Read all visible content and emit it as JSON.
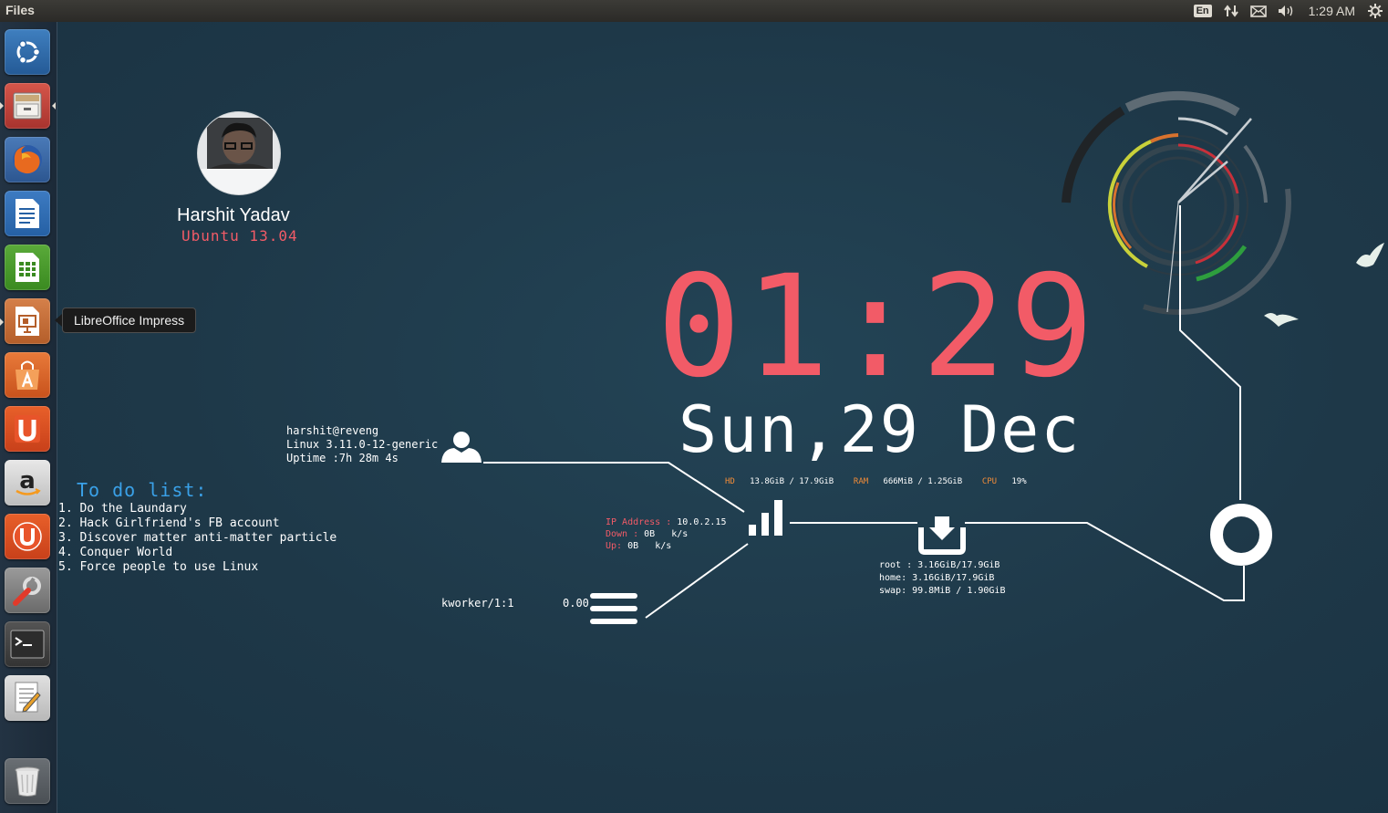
{
  "top_panel": {
    "app_title": "Files",
    "keyboard_layout": "En",
    "clock": "1:29 AM",
    "icons": [
      "network-transfer-icon",
      "mail-icon",
      "volume-icon",
      "gear-icon"
    ]
  },
  "launcher": {
    "items": [
      {
        "name": "dash-home",
        "icon": "ubuntu-logo-icon"
      },
      {
        "name": "files",
        "icon": "file-cabinet-icon",
        "active": true
      },
      {
        "name": "firefox",
        "icon": "firefox-icon"
      },
      {
        "name": "libreoffice-writer",
        "icon": "writer-icon"
      },
      {
        "name": "libreoffice-calc",
        "icon": "calc-icon"
      },
      {
        "name": "libreoffice-impress",
        "icon": "impress-icon"
      },
      {
        "name": "ubuntu-software-center",
        "icon": "shopping-bag-icon"
      },
      {
        "name": "ubuntu-one",
        "icon": "ubuntu-one-icon"
      },
      {
        "name": "amazon",
        "icon": "amazon-icon"
      },
      {
        "name": "ubuntu-one-music",
        "icon": "ubuntu-one-music-icon"
      },
      {
        "name": "system-settings",
        "icon": "wrench-icon"
      },
      {
        "name": "terminal",
        "icon": "terminal-icon"
      },
      {
        "name": "text-editor",
        "icon": "text-editor-icon"
      },
      {
        "name": "trash",
        "icon": "trash-icon"
      }
    ],
    "tooltip": "LibreOffice Impress"
  },
  "conky": {
    "user_name": "Harshit Yadav",
    "os_version": "Ubuntu 13.04",
    "time": "01:29",
    "date": "Sun,29 Dec",
    "stats": {
      "hd_label": "HD",
      "hd_value": "13.8GiB / 17.9GiB",
      "ram_label": "RAM",
      "ram_value": "666MiB / 1.25GiB",
      "cpu_label": "CPU",
      "cpu_value": "19%"
    },
    "user_info": {
      "login": "harshit@reveng",
      "kernel": "Linux 3.11.0-12-generic",
      "uptime": "Uptime :7h 28m 4s"
    },
    "todo": {
      "title": "To do list:",
      "items": [
        "1. Do the Laundary",
        "2. Hack Girlfriend's FB account",
        "3. Discover matter anti-matter particle",
        "4. Conquer World",
        "5. Force people to use Linux"
      ]
    },
    "network": {
      "ip_label": "IP Address :",
      "ip_value": "10.0.2.15",
      "down_label": "Down :",
      "down_value": "0B   k/s",
      "up_label": "Up:",
      "up_value": "0B   k/s"
    },
    "disks": {
      "root": "root : 3.16GiB/17.9GiB",
      "home": "home: 3.16GiB/17.9GiB",
      "swap": "swap: 99.8MiB / 1.90GiB"
    },
    "process": {
      "name": "kworker/1:1",
      "value": "0.00"
    },
    "colors": {
      "accent_red": "#f25b67",
      "todo_blue": "#3aa1e8",
      "stat_orange": "#f28c38",
      "ring_yellow": "#c8d13a",
      "ring_green": "#2e9e3e",
      "ring_red": "#c9303a"
    }
  }
}
